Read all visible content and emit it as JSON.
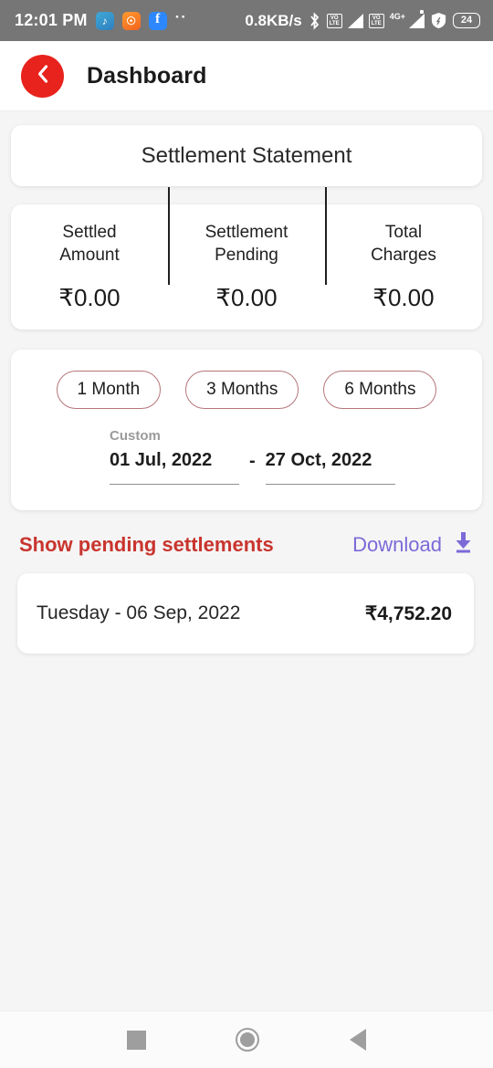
{
  "statusbar": {
    "time": "12:01 PM",
    "notification_icons": [
      "notes-app-icon",
      "orange-app-icon",
      "facebook-icon"
    ],
    "overflow_dots": "··",
    "network_speed": "0.8KB/s",
    "bluetooth_icon": "bluetooth-icon",
    "volte_label_1": "VO",
    "volte_sub_1": "LTE",
    "volte_label_2": "VO",
    "volte_sub_2": "LTE",
    "network_type": "4G+",
    "vpn_icon": "vpn-shield-icon",
    "battery_level": "24"
  },
  "appbar": {
    "back_icon": "chevron-left-icon",
    "back_color": "#e8221c",
    "title": "Dashboard"
  },
  "statement": {
    "title": "Settlement Statement"
  },
  "summary": {
    "items": [
      {
        "label": "Settled\nAmount",
        "label_line1": "Settled",
        "label_line2": "Amount",
        "value": "₹0.00"
      },
      {
        "label": "Settlement\nPending",
        "label_line1": "Settlement",
        "label_line2": "Pending",
        "value": "₹0.00"
      },
      {
        "label": "Total\nCharges",
        "label_line1": "Total",
        "label_line2": "Charges",
        "value": "₹0.00"
      }
    ]
  },
  "filter": {
    "chips": [
      {
        "label": "1 Month",
        "selected": false
      },
      {
        "label": "3 Months",
        "selected": false
      },
      {
        "label": "6 Months",
        "selected": false
      }
    ],
    "chip_border_color": "#b5767a",
    "custom_label": "Custom",
    "start_date": "01 Jul, 2022",
    "separator": "-",
    "end_date": "27 Oct, 2022"
  },
  "actions": {
    "pending_link": "Show pending settlements",
    "pending_color": "#c9342e",
    "download_label": "Download",
    "download_color": "#7b6ad8",
    "download_icon": "download-arrow-icon"
  },
  "settlements": {
    "rows": [
      {
        "date": "Tuesday - 06 Sep, 2022",
        "amount": "₹4,752.20"
      }
    ]
  },
  "navbar": {
    "recents": "recents-square-icon",
    "home": "home-circle-icon",
    "back": "back-triangle-icon"
  }
}
